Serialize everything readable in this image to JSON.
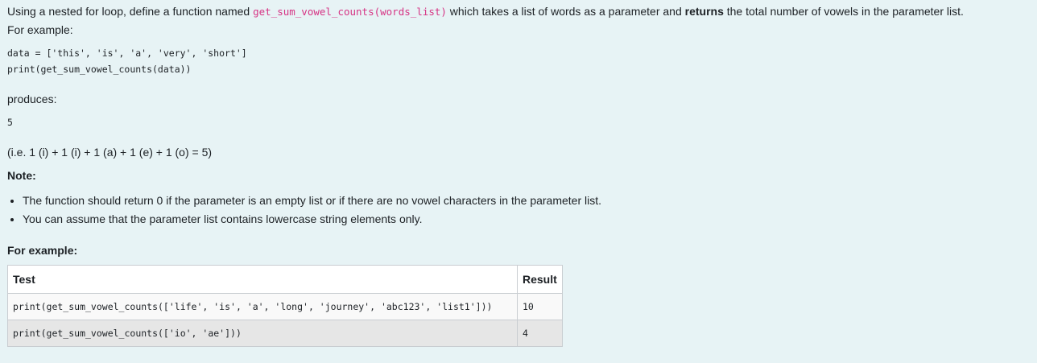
{
  "intro": {
    "before_code": "Using a nested for loop, define a function named ",
    "function_signature": "get_sum_vowel_counts(words_list)",
    "after_code": " which takes a list of words as a parameter and ",
    "bold_word": "returns",
    "end": " the total number of vowels in the parameter list.",
    "for_example": "For example:"
  },
  "code_example": {
    "line1": "data = ['this', 'is', 'a', 'very', 'short']",
    "line2": "print(get_sum_vowel_counts(data))"
  },
  "produces_label": "produces:",
  "output_value": "5",
  "explanation": "(i.e. 1 (i) + 1 (i) + 1 (a) + 1 (e) + 1 (o) = 5)",
  "note": {
    "heading": "Note:",
    "items": [
      "The function should return 0 if the parameter is an empty list or if there are no vowel characters in the parameter list.",
      "You can assume that the parameter list contains lowercase string elements only."
    ]
  },
  "example_heading": "For example:",
  "test_table": {
    "headers": {
      "test": "Test",
      "result": "Result"
    },
    "rows": [
      {
        "test": "print(get_sum_vowel_counts(['life', 'is', 'a', 'long', 'journey', 'abc123', 'list1']))",
        "result": "10"
      },
      {
        "test": "print(get_sum_vowel_counts(['io', 'ae']))",
        "result": "4"
      }
    ]
  },
  "colors": {
    "page_background": "#e7f3f5",
    "inline_code": "#d63384",
    "text": "#1d2125",
    "table_border": "#c9cdd1",
    "row_alt": "#e6e6e6"
  }
}
